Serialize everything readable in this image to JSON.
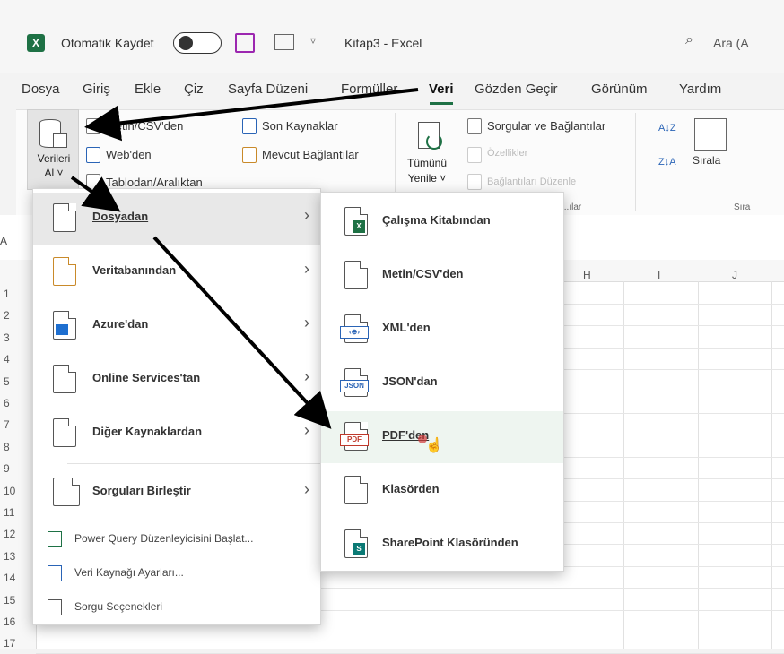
{
  "titlebar": {
    "autosave_label": "Otomatik Kaydet",
    "doc_title": "Kitap3 - Excel",
    "search_placeholder": "Ara (A",
    "excel_badge": "X"
  },
  "tabs": [
    {
      "label": "Dosya"
    },
    {
      "label": "Giriş"
    },
    {
      "label": "Ekle"
    },
    {
      "label": "Çiz"
    },
    {
      "label": "Sayfa Düzeni"
    },
    {
      "label": "Formüller"
    },
    {
      "label": "Veri"
    },
    {
      "label": "Gözden Geçir"
    },
    {
      "label": "Görünüm"
    },
    {
      "label": "Yardım"
    }
  ],
  "ribbon": {
    "get_data": [
      "Verileri",
      "Al ˅"
    ],
    "text_csv": "Metin/CSV'den",
    "web": "Web'den",
    "table_range": "Tablodan/Aralıktan",
    "recent_sources": "Son Kaynaklar",
    "existing_connections": "Mevcut Bağlantılar",
    "refresh_all": [
      "Tümünü",
      "Yenile ˅"
    ],
    "queries_connections": "Sorgular ve Bağlantılar",
    "properties": "Özellikler",
    "edit_links": "Bağlantıları Düzenle",
    "group_queries": "...ılar",
    "sort": "Sırala",
    "group_sort": "Sıra",
    "sort_az": "A↓Z",
    "sort_za": "Z↓A"
  },
  "grid": {
    "name_box": "A",
    "columns": [
      "H",
      "I",
      "J"
    ],
    "rows": [
      "1",
      "2",
      "3",
      "4",
      "5",
      "6",
      "7",
      "8",
      "9",
      "10",
      "11",
      "12",
      "13",
      "14",
      "15",
      "16",
      "17"
    ]
  },
  "get_data_menu": {
    "items": [
      {
        "label": "Dosyadan",
        "selected": true,
        "icon": "file-icon"
      },
      {
        "label": "Veritabanından",
        "icon": "database-icon"
      },
      {
        "label": "Azure'dan",
        "icon": "azure-icon"
      },
      {
        "label": "Online Services'tan",
        "icon": "cloud-icon"
      },
      {
        "label": "Diğer Kaynaklardan",
        "icon": "other-sources-icon"
      },
      {
        "label": "Sorguları Birleştir",
        "icon": "combine-queries-icon"
      }
    ],
    "footer": [
      {
        "label": "Power Query Düzenleyicisini Başlat...",
        "icon": "power-query-icon"
      },
      {
        "label": "Veri Kaynağı Ayarları...",
        "icon": "data-source-settings-icon"
      },
      {
        "label": "Sorgu Seçenekleri",
        "icon": "query-options-icon"
      }
    ],
    "chevron": "›"
  },
  "from_file_submenu": {
    "items": [
      {
        "label": "Çalışma Kitabından",
        "icon": "workbook-icon"
      },
      {
        "label": "Metin/CSV'den",
        "icon": "text-csv-icon"
      },
      {
        "label": "XML'den",
        "icon": "xml-icon"
      },
      {
        "label": "JSON'dan",
        "icon": "json-icon"
      },
      {
        "label": "PDF'den",
        "icon": "pdf-icon",
        "highlighted": true
      },
      {
        "label": "Klasörden",
        "icon": "folder-icon"
      },
      {
        "label": "SharePoint Klasöründen",
        "icon": "sharepoint-folder-icon"
      }
    ],
    "badges": {
      "xml": "‹⊕›",
      "json": "JSON",
      "pdf": "PDF",
      "xl": "X",
      "sp": "S"
    }
  },
  "colors": {
    "excel_green": "#1e7145",
    "save_purple": "#8a2be2",
    "arrow": "#000000",
    "cursor_red": "#d23b3b"
  }
}
